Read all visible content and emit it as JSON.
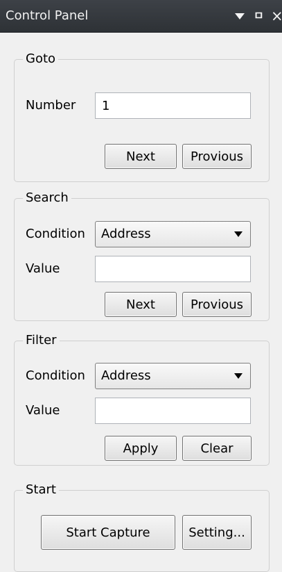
{
  "titlebar": {
    "title": "Control Panel",
    "menu_icon": "dropdown-arrow",
    "pin_glyph": "ㅁ",
    "close_glyph": "×"
  },
  "goto": {
    "title": "Goto",
    "number_label": "Number",
    "number_value": "1",
    "next_label": "Next",
    "previous_label": "Provious"
  },
  "search": {
    "title": "Search",
    "condition_label": "Condition",
    "condition_value": "Address",
    "value_label": "Value",
    "value_text": "",
    "next_label": "Next",
    "previous_label": "Provious"
  },
  "filter": {
    "title": "Filter",
    "condition_label": "Condition",
    "condition_value": "Address",
    "value_label": "Value",
    "value_text": "",
    "apply_label": "Apply",
    "clear_label": "Clear"
  },
  "start": {
    "title": "Start",
    "start_capture_label": "Start Capture",
    "setting_label": "Setting..."
  }
}
